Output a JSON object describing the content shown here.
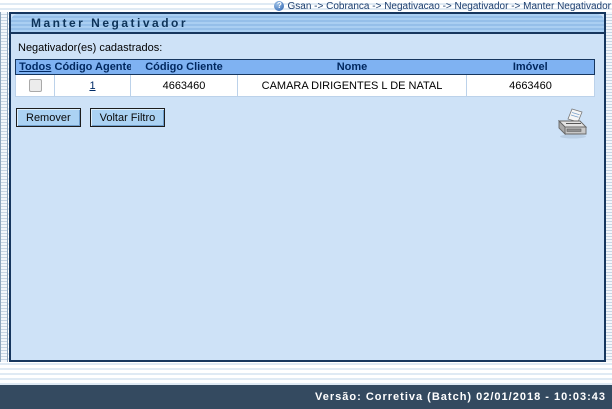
{
  "breadcrumb": {
    "path": "Gsan -> Cobranca -> Negativacao -> Negativador -> Manter Negativador",
    "help_icon_glyph": "?"
  },
  "panel": {
    "title": "Manter Negativador",
    "subtitle": "Negativador(es) cadastrados:"
  },
  "table": {
    "columns": [
      {
        "label": "Todos"
      },
      {
        "label": "Código Agente"
      },
      {
        "label": "Código Cliente"
      },
      {
        "label": "Nome"
      },
      {
        "label": "Imóvel"
      }
    ],
    "rows": [
      {
        "selected": false,
        "codigo_agente": "1",
        "codigo_cliente": "4663460",
        "nome": "CAMARA DIRIGENTES L DE NATAL",
        "imovel": "4663460"
      }
    ]
  },
  "buttons": {
    "remover": "Remover",
    "voltar_filtro": "Voltar Filtro"
  },
  "icons": {
    "print": "printer-icon"
  },
  "footer": {
    "version_text": "Versão: Corretiva (Batch) 02/01/2018 - 10:03:43"
  },
  "colors": {
    "panel_bg": "#cee2f7",
    "panel_border": "#16365e",
    "table_header_bg": "#7fb2f2",
    "title_text": "#0d3359",
    "link": "#002a66",
    "footer_bg": "#344a60",
    "footer_text": "#ffffff"
  }
}
